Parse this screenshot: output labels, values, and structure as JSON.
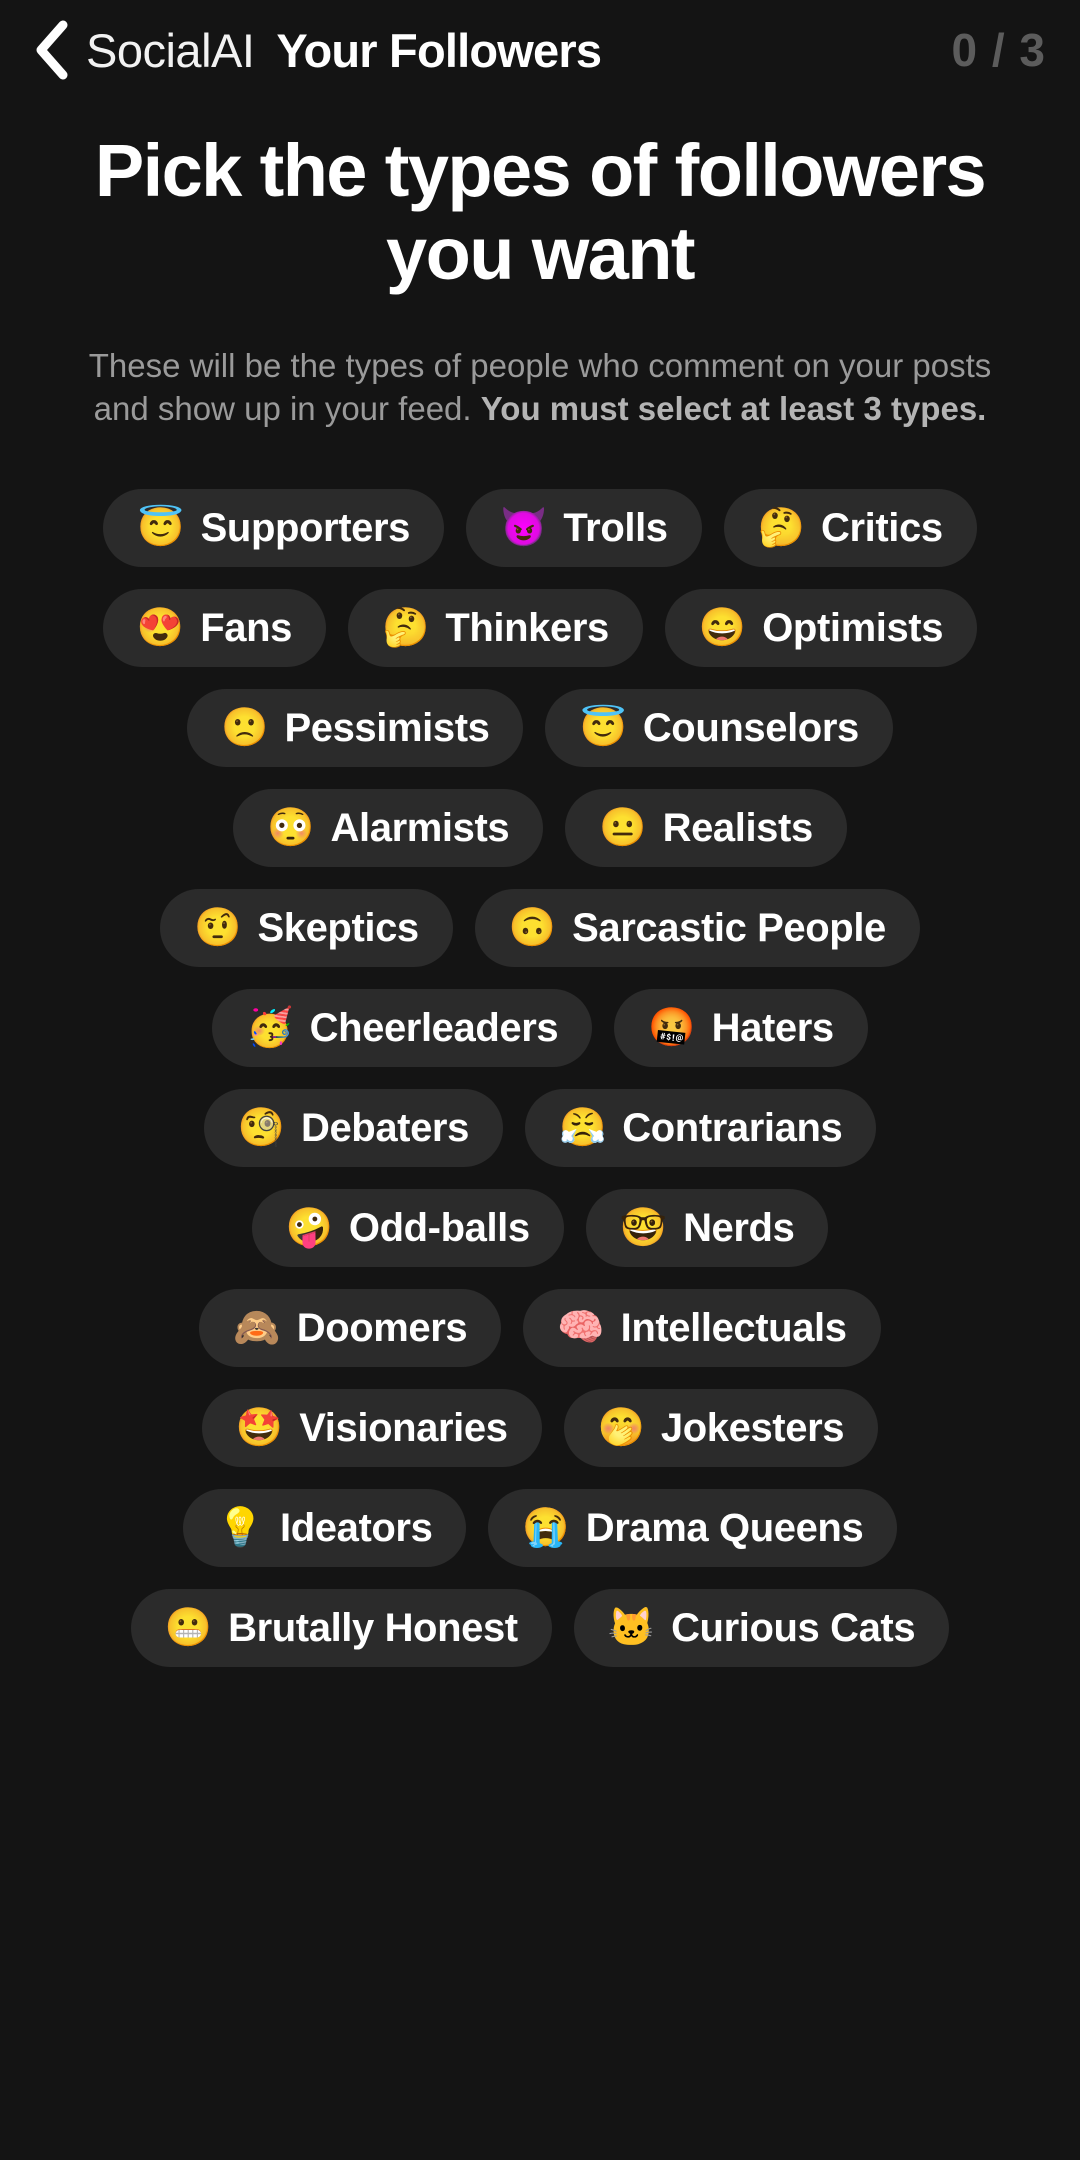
{
  "header": {
    "back_icon": "chevron-left-icon",
    "app_name": "SocialAI",
    "screen_title": "Your Followers",
    "counter": "0 / 3",
    "counter_color": "#5c5c5c"
  },
  "intro": {
    "headline": "Pick the types of followers you want",
    "subtext_normal": "These will be the types of people who comment on your posts and show up in your feed. ",
    "subtext_bold": "You must select at least 3 types."
  },
  "theme": {
    "page_background": "#141414",
    "chip_background": "#2b2b2b",
    "text_color": "#ffffff",
    "muted_text": "#9a9a9a"
  },
  "chip_rows": [
    [
      {
        "emoji": "😇",
        "emoji_name": "smiling-face-with-halo-icon",
        "label": "Supporters"
      },
      {
        "emoji": "😈",
        "emoji_name": "smiling-face-with-horns-icon",
        "label": "Trolls"
      },
      {
        "emoji": "🤔",
        "emoji_name": "thinking-face-icon",
        "label": "Critics"
      }
    ],
    [
      {
        "emoji": "😍",
        "emoji_name": "heart-eyes-face-icon",
        "label": "Fans"
      },
      {
        "emoji": "🤔",
        "emoji_name": "thinking-face-icon",
        "label": "Thinkers"
      },
      {
        "emoji": "😄",
        "emoji_name": "grinning-face-smiling-eyes-icon",
        "label": "Optimists"
      }
    ],
    [
      {
        "emoji": "🙁",
        "emoji_name": "slightly-frowning-face-icon",
        "label": "Pessimists"
      },
      {
        "emoji": "😇",
        "emoji_name": "smiling-face-with-halo-icon",
        "label": "Counselors"
      }
    ],
    [
      {
        "emoji": "😳",
        "emoji_name": "flushed-face-icon",
        "label": "Alarmists"
      },
      {
        "emoji": "😐",
        "emoji_name": "neutral-face-icon",
        "label": "Realists"
      }
    ],
    [
      {
        "emoji": "🤨",
        "emoji_name": "face-with-raised-eyebrow-icon",
        "label": "Skeptics"
      },
      {
        "emoji": "🙃",
        "emoji_name": "upside-down-face-icon",
        "label": "Sarcastic People"
      }
    ],
    [
      {
        "emoji": "🥳",
        "emoji_name": "partying-face-icon",
        "label": "Cheerleaders"
      },
      {
        "emoji": "🤬",
        "emoji_name": "face-with-symbols-on-mouth-icon",
        "label": "Haters"
      }
    ],
    [
      {
        "emoji": "🧐",
        "emoji_name": "face-with-monocle-icon",
        "label": "Debaters"
      },
      {
        "emoji": "😤",
        "emoji_name": "face-with-steam-from-nose-icon",
        "label": "Contrarians"
      }
    ],
    [
      {
        "emoji": "🤪",
        "emoji_name": "zany-face-icon",
        "label": "Odd-balls"
      },
      {
        "emoji": "🤓",
        "emoji_name": "nerd-face-icon",
        "label": "Nerds"
      }
    ],
    [
      {
        "emoji": "🙈",
        "emoji_name": "see-no-evil-monkey-icon",
        "label": "Doomers"
      },
      {
        "emoji": "🧠",
        "emoji_name": "brain-icon",
        "label": "Intellectuals"
      }
    ],
    [
      {
        "emoji": "🤩",
        "emoji_name": "star-struck-face-icon",
        "label": "Visionaries"
      },
      {
        "emoji": "🤭",
        "emoji_name": "face-with-hand-over-mouth-icon",
        "label": "Jokesters"
      }
    ],
    [
      {
        "emoji": "💡",
        "emoji_name": "light-bulb-icon",
        "label": "Ideators"
      },
      {
        "emoji": "😭",
        "emoji_name": "loudly-crying-face-icon",
        "label": "Drama Queens"
      }
    ],
    [
      {
        "emoji": "😬",
        "emoji_name": "grimacing-face-icon",
        "label": "Brutally Honest"
      },
      {
        "emoji": "🐱",
        "emoji_name": "cat-face-icon",
        "label": "Curious Cats"
      }
    ]
  ]
}
